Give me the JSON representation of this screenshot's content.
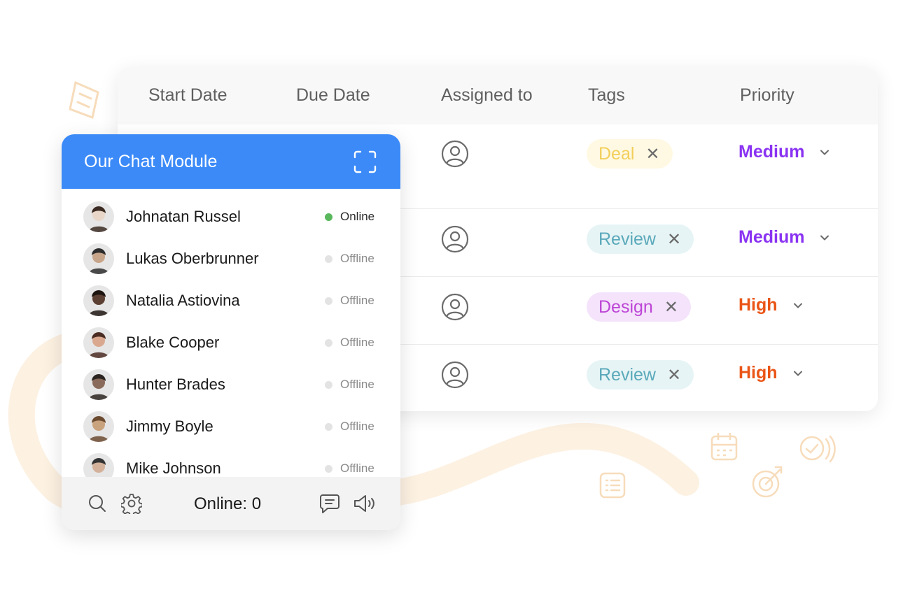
{
  "table": {
    "columns": [
      "Start Date",
      "Due Date",
      "Assigned to",
      "Tags",
      "Priority"
    ],
    "rows": [
      {
        "tag": "Deal",
        "tag_color": "#f2cf5b",
        "tag_bg": "#fff9e3",
        "priority": "Medium",
        "priority_color": "#8a33f2"
      },
      {
        "tag": "Review",
        "tag_color": "#5aa9ba",
        "tag_bg": "#e6f4f5",
        "priority": "Medium",
        "priority_color": "#8a33f2"
      },
      {
        "tag": "Design",
        "tag_color": "#bd45d6",
        "tag_bg": "#f4e3fb",
        "priority": "High",
        "priority_color": "#ea5517"
      },
      {
        "tag": "Review",
        "tag_color": "#5aa9ba",
        "tag_bg": "#e6f4f5",
        "priority": "High",
        "priority_color": "#ea5517"
      }
    ],
    "assignee_icon": "user-circle-icon",
    "remove_icon": "close-icon"
  },
  "chat": {
    "title": "Our Chat Module",
    "header_color": "#3b8af8",
    "contacts": [
      {
        "name": "Johnatan Russel",
        "status": "Online"
      },
      {
        "name": "Lukas Oberbrunner",
        "status": "Offline"
      },
      {
        "name": "Natalia Astiovina",
        "status": "Offline"
      },
      {
        "name": "Blake Cooper",
        "status": "Offline"
      },
      {
        "name": "Hunter Brades",
        "status": "Offline"
      },
      {
        "name": "Jimmy Boyle",
        "status": "Offline"
      },
      {
        "name": "Mike Johnson",
        "status": "Offline"
      }
    ],
    "footer": {
      "online_text": "Online: 0",
      "icons": [
        "search-icon",
        "gear-icon",
        "chat-icon",
        "speaker-icon"
      ]
    }
  }
}
